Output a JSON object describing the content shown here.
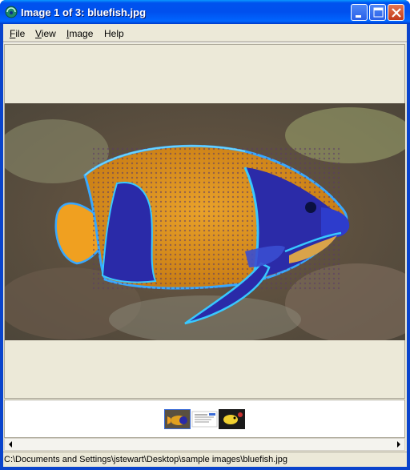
{
  "window": {
    "title": "Image 1 of 3: bluefish.jpg"
  },
  "menu": {
    "items": [
      {
        "key": "F",
        "rest": "ile"
      },
      {
        "key": "V",
        "rest": "iew"
      },
      {
        "key": "I",
        "rest": "mage"
      },
      {
        "key": "",
        "rest": "Help"
      }
    ]
  },
  "thumbnails": [
    {
      "icon": "fish-thumbnail"
    },
    {
      "icon": "document-thumbnail"
    },
    {
      "icon": "yellowfish-thumbnail"
    }
  ],
  "status": {
    "path": "C:\\Documents and Settings\\jstewart\\Desktop\\sample images\\bluefish.jpg"
  },
  "colors": {
    "titlebar": "#0053ee",
    "client": "#ece9d8",
    "close_button": "#c1391b"
  }
}
